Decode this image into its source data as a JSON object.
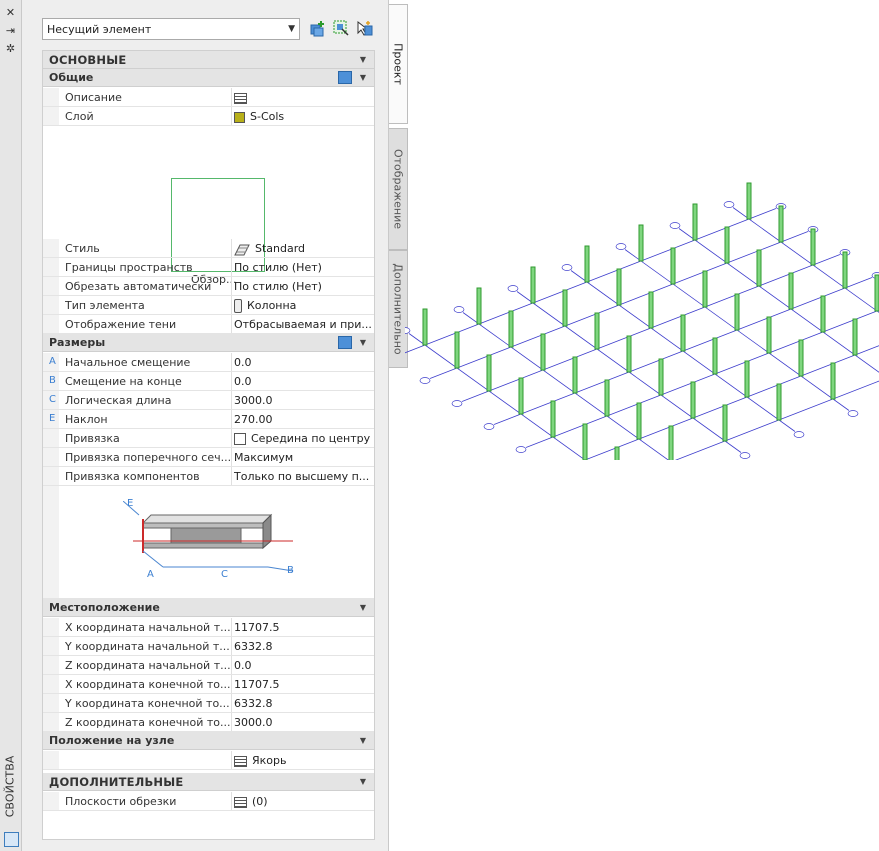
{
  "left_strip": {
    "title": "СВОЙСТВА",
    "icons": [
      "close-icon",
      "auto-hide-icon",
      "settings-icon",
      "palette-properties-icon"
    ]
  },
  "selector": {
    "value": "Несущий элемент"
  },
  "toolbar": {
    "icons": [
      "add-selected-icon",
      "quick-select-icon",
      "select-objects-icon"
    ]
  },
  "tabs": [
    "Проект",
    "Отображение",
    "Дополнительно"
  ],
  "sections": {
    "basic": "ОСНОВНЫЕ",
    "general": {
      "title": "Общие",
      "description": {
        "name": "Описание",
        "value": ""
      },
      "layer": {
        "name": "Слой",
        "value": "S-Cols"
      },
      "preview_label": "Обзор...",
      "style": {
        "name": "Стиль",
        "value": "Standard"
      },
      "space_bounds": {
        "name": "Границы пространств",
        "value": "По стилю (Нет)"
      },
      "auto_trim": {
        "name": "Обрезать автоматически",
        "value": "По стилю (Нет)"
      },
      "element_type": {
        "name": "Тип элемента",
        "value": "Колонна"
      },
      "shadow": {
        "name": "Отображение тени",
        "value": "Отбрасываемая и при..."
      }
    },
    "dimensions": {
      "title": "Размеры",
      "start_offset": {
        "letter": "A",
        "name": "Начальное смещение",
        "value": "0.0"
      },
      "end_offset": {
        "letter": "B",
        "name": "Смещение на конце",
        "value": "0.0"
      },
      "logical_length": {
        "letter": "C",
        "name": "Логическая длина",
        "value": "3000.0"
      },
      "roll": {
        "letter": "E",
        "name": "Наклон",
        "value": "270.00"
      },
      "justify": {
        "name": "Привязка",
        "value": "Середина по центру"
      },
      "justify_cross": {
        "name": "Привязка поперечного сеч...",
        "value": "Максимум"
      },
      "justify_components": {
        "name": "Привязка компонентов",
        "value": "Только по высшему п..."
      },
      "diagram_labels": {
        "a": "A",
        "b": "B",
        "c": "C",
        "e": "E"
      }
    },
    "location": {
      "title": "Местоположение",
      "start_x": {
        "name": "X координата начальной т...",
        "value": "11707.5"
      },
      "start_y": {
        "name": "Y координата начальной т...",
        "value": "6332.8"
      },
      "start_z": {
        "name": "Z координата начальной т...",
        "value": "0.0"
      },
      "end_x": {
        "name": "X координата конечной то...",
        "value": "11707.5"
      },
      "end_y": {
        "name": "Y координата конечной то...",
        "value": "6332.8"
      },
      "end_z": {
        "name": "Z координата конечной то...",
        "value": "3000.0"
      }
    },
    "anchor": {
      "title": "Положение на узле",
      "value": "Якорь"
    },
    "additional": {
      "title": "ДОПОЛНИТЕЛЬНЫЕ",
      "trim_planes": {
        "name": "Плоскости обрезки",
        "value": "(0)"
      }
    }
  },
  "colors": {
    "column": "#2f9a2f",
    "grid_line": "#3d3dcc",
    "layer_swatch": "#b8b01a",
    "dimension_letter": "#3b7fd1"
  },
  "drawing": {
    "grid_columns": 7,
    "grid_rows": 7
  }
}
